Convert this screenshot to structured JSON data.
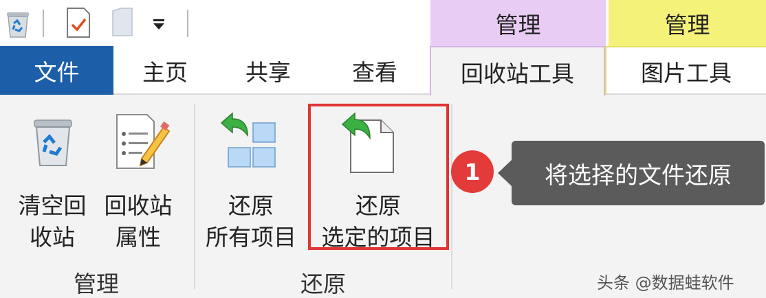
{
  "context_headers": {
    "recycle_manage": "管理",
    "picture_manage": "管理"
  },
  "tabs": {
    "file": "文件",
    "home": "主页",
    "share": "共享",
    "view": "查看",
    "recycle_tools": "回收站工具",
    "picture_tools": "图片工具"
  },
  "ribbon": {
    "empty_recycle_bin": "清空回\n收站",
    "recycle_bin_properties": "回收站\n属性",
    "restore_all": "还原\n所有项目",
    "restore_selected": "还原\n选定的项目",
    "group_manage": "管理",
    "group_restore": "还原"
  },
  "annotation": {
    "badge": "1",
    "callout": "将选择的文件还原"
  },
  "watermark": "头条 @数据蛙软件",
  "colors": {
    "file_tab": "#1c5fa8",
    "recycle_context": "#e8ccf4",
    "picture_context": "#f4f278",
    "highlight": "#e13434"
  }
}
